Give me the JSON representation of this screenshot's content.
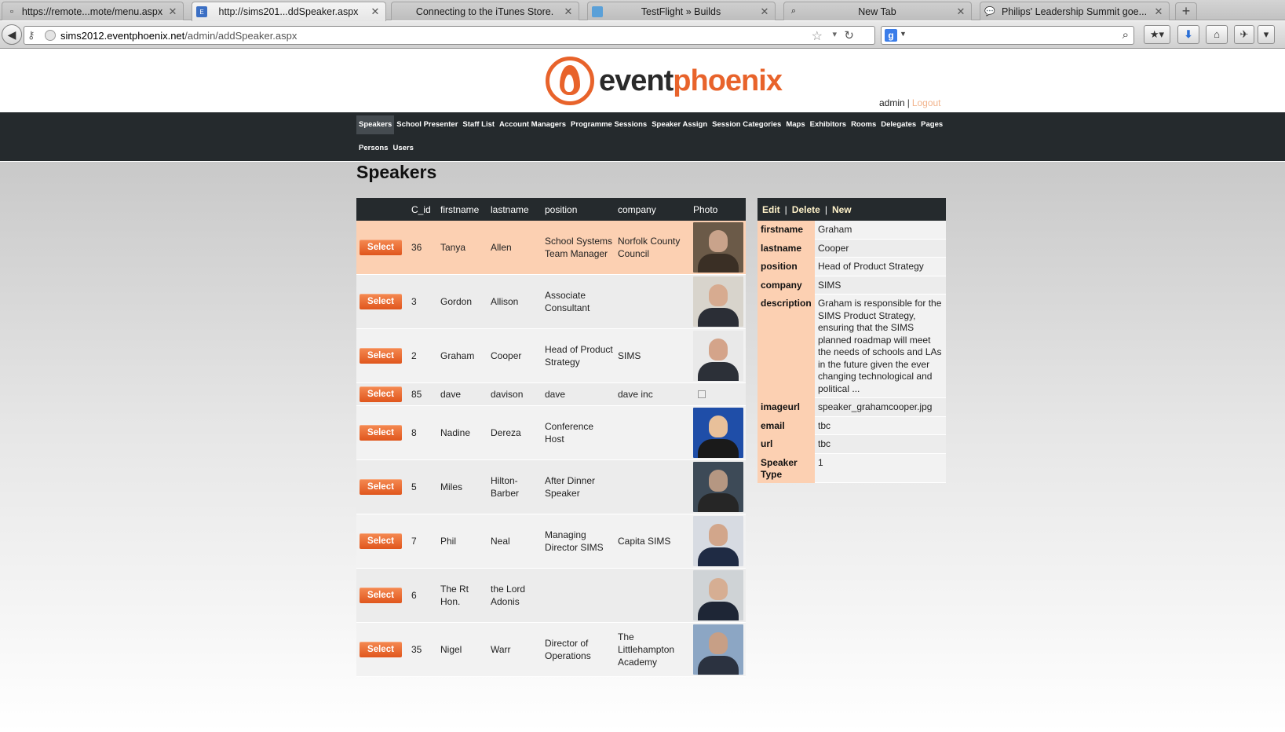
{
  "browser": {
    "tabs": [
      {
        "label": "https://remote...mote/menu.aspx",
        "icon": "page-icon",
        "active": false
      },
      {
        "label": "http://sims201...ddSpeaker.aspx",
        "icon": "site-favicon",
        "active": true
      },
      {
        "label": "Connecting to the iTunes Store.",
        "icon": "apple-icon",
        "active": false
      },
      {
        "label": "TestFlight » Builds",
        "icon": "testflight-icon",
        "active": false
      },
      {
        "label": "New Tab",
        "icon": "search-icon",
        "active": false
      },
      {
        "label": "Philips' Leadership Summit goe...",
        "icon": "speech-bubble-icon",
        "active": false
      }
    ],
    "new_tab_label": "+",
    "url_host": "sims2012.eventphoenix.net",
    "url_path": "/admin/addSpeaker.aspx",
    "search_engine": "g"
  },
  "header": {
    "logo_part1": "event",
    "logo_part2": "phoenix",
    "user": "admin",
    "separator": "|",
    "logout": "Logout"
  },
  "nav": {
    "row1": [
      "Speakers",
      "School Presenter",
      "Staff List",
      "Account Managers",
      "Programme Sessions",
      "Speaker Assign",
      "Session Categories",
      "Maps",
      "Exhibitors",
      "Rooms",
      "Delegates",
      "Pages"
    ],
    "row2": [
      "Persons",
      "Users"
    ],
    "active": "Speakers"
  },
  "page_title": "Speakers",
  "grid": {
    "columns": [
      "",
      "C_id",
      "firstname",
      "lastname",
      "position",
      "company",
      "Photo"
    ],
    "select_label": "Select",
    "rows": [
      {
        "c_id": "36",
        "firstname": "Tanya",
        "lastname": "Allen",
        "position": "School Systems Team Manager",
        "company": "Norfolk County Council",
        "photo": "photo-tanya-allen",
        "selected": true
      },
      {
        "c_id": "3",
        "firstname": "Gordon",
        "lastname": "Allison",
        "position": "Associate Consultant",
        "company": "",
        "photo": "photo-gordon-allison",
        "selected": false
      },
      {
        "c_id": "2",
        "firstname": "Graham",
        "lastname": "Cooper",
        "position": "Head of Product Strategy",
        "company": "SIMS",
        "photo": "photo-graham-cooper",
        "selected": false
      },
      {
        "c_id": "85",
        "firstname": "dave",
        "lastname": "davison",
        "position": "dave",
        "company": "dave inc",
        "photo": "broken-image-icon",
        "selected": false
      },
      {
        "c_id": "8",
        "firstname": "Nadine",
        "lastname": "Dereza",
        "position": "Conference Host",
        "company": "",
        "photo": "photo-nadine-dereza",
        "selected": false
      },
      {
        "c_id": "5",
        "firstname": "Miles",
        "lastname": "Hilton-Barber",
        "position": "After Dinner Speaker",
        "company": "",
        "photo": "photo-miles-hilton-barber",
        "selected": false
      },
      {
        "c_id": "7",
        "firstname": "Phil",
        "lastname": "Neal",
        "position": "Managing Director SIMS",
        "company": "Capita SIMS",
        "photo": "photo-phil-neal",
        "selected": false
      },
      {
        "c_id": "6",
        "firstname": "The Rt Hon.",
        "lastname": "the Lord Adonis",
        "position": "",
        "company": "",
        "photo": "photo-lord-adonis",
        "selected": false
      },
      {
        "c_id": "35",
        "firstname": "Nigel",
        "lastname": "Warr",
        "position": "Director of Operations",
        "company": "The Littlehampton Academy",
        "photo": "photo-nigel-warr",
        "selected": false
      }
    ]
  },
  "detail": {
    "actions": [
      "Edit",
      "Delete",
      "New"
    ],
    "fields": [
      {
        "key": "firstname",
        "value": "Graham"
      },
      {
        "key": "lastname",
        "value": "Cooper"
      },
      {
        "key": "position",
        "value": "Head of Product Strategy"
      },
      {
        "key": "company",
        "value": "SIMS"
      },
      {
        "key": "description",
        "value": "Graham is responsible for the SIMS Product Strategy, ensuring that the SIMS planned roadmap will meet the needs of schools and LAs in the future given the ever changing technological and political ..."
      },
      {
        "key": "imageurl",
        "value": "speaker_grahamcooper.jpg"
      },
      {
        "key": "email",
        "value": "tbc"
      },
      {
        "key": "url",
        "value": "tbc"
      },
      {
        "key": "Speaker Type",
        "value": "1"
      }
    ]
  },
  "colors": {
    "accent": "#e8632b",
    "nav_bg": "#252a2d",
    "selected_row": "#fcd0b2",
    "logout_link": "#f2b48d"
  }
}
